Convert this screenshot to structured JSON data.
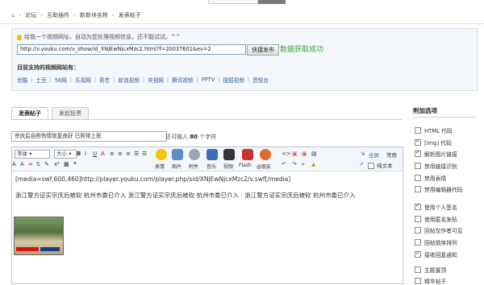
{
  "breadcrumb": [
    "论坛",
    "互助插件",
    "新新块名称",
    "发表帖子"
  ],
  "video": {
    "tip": "给我一个视频网址，自动为您处理视频信息，还不能试试。^^",
    "url": "http://v.youku.com/v_show/id_XNjEwNjcxMzc2.html?f=20037601&ev=2",
    "button": "快捷发布",
    "status": "数据获取成功",
    "status_color": "#3aa63a",
    "sites_title": "目前支持的视频网站有：",
    "sites": [
      "优酷",
      "土豆",
      "56网",
      "乐视网",
      "奇艺",
      "新浪视频",
      "央视网",
      "腾讯视频",
      "PPTV",
      "搜狐视频",
      "音悦台"
    ]
  },
  "tabs": [
    "发表帖子",
    "发起投票"
  ],
  "subject": {
    "value": "宗庆后自称伤情恢复良好 已照常上班",
    "counter_prefix": "还可输入",
    "counter_value": "80",
    "counter_suffix": "个字符"
  },
  "toolbar": {
    "font_select": "字体",
    "size_select": "大小",
    "buttons": [
      "表情",
      "图片",
      "附件",
      "音乐",
      "视频",
      "Flash",
      "@朋友",
      "代码"
    ],
    "fullscreen": "全屏",
    "common": "常用",
    "plaintext": "纯文本"
  },
  "editor": {
    "line1": "[media=swf,600,460]http://player.youku.com/player.php/sid/XNjEwNjcxMzc2/v.swf[/media]",
    "line2": "浙江警方证实宗庆后被砍 杭州市委已介入 浙江警方证实宗庆后被砍 杭州市委已介入 · 浙江警方证实宗庆后被砍 杭州市委已介入"
  },
  "sidebar": {
    "title": "附加选项",
    "options": [
      {
        "label": "HTML 代码",
        "checked": false
      },
      {
        "label": "[img] 代码",
        "checked": true
      },
      {
        "label": "解析图片链接",
        "checked": true
      },
      {
        "label": "禁用链接识别",
        "checked": false
      },
      {
        "label": "禁用表情",
        "checked": false
      },
      {
        "label": "禁用编辑器代码",
        "checked": false
      },
      {
        "label": "使用个人签名",
        "checked": true
      },
      {
        "label": "使用匿名发帖",
        "checked": false
      },
      {
        "label": "回帖仅作者可见",
        "checked": false
      },
      {
        "label": "回帖倒序排列",
        "checked": false
      },
      {
        "label": "接收回复通知",
        "checked": true
      },
      {
        "label": "主题置顶",
        "checked": false
      },
      {
        "label": "精华帖子",
        "checked": false
      }
    ]
  }
}
